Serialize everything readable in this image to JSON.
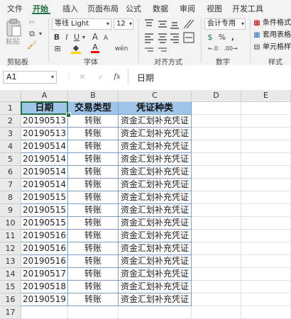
{
  "tabs": [
    "文件",
    "开始",
    "插入",
    "页面布局",
    "公式",
    "数据",
    "审阅",
    "视图",
    "开发工具"
  ],
  "ribbon": {
    "clipboard": {
      "paste_label": "粘贴",
      "group_label": "剪贴板"
    },
    "font": {
      "font_name": "等线 Light",
      "font_size": "12",
      "bold": "B",
      "italic": "I",
      "underline": "U",
      "grow": "A",
      "shrink": "A",
      "font_color": "A",
      "phonetic": "wén",
      "group_label": "字体"
    },
    "alignment": {
      "group_label": "对齐方式"
    },
    "number": {
      "format": "会计专用",
      "percent": "%",
      "comma": ",",
      "currency": "$",
      "group_label": "数字"
    },
    "styles": {
      "conditional": "条件格式",
      "table": "套用表格格",
      "cell": "单元格样式",
      "group_label": "样式"
    }
  },
  "formula_bar": {
    "name_box": "A1",
    "fx": "fx",
    "cancel": "✕",
    "enter": "✓",
    "content": "日期"
  },
  "columns": [
    "A",
    "B",
    "C",
    "D",
    "E"
  ],
  "rows": [
    "1",
    "2",
    "3",
    "4",
    "5",
    "6",
    "7",
    "8",
    "9",
    "10",
    "11",
    "12",
    "13",
    "14",
    "15",
    "16",
    "17"
  ],
  "table": {
    "headers": [
      "日期",
      "交易类型",
      "凭证种类"
    ],
    "data": [
      [
        "20190513",
        "转账",
        "资金汇划补充凭证"
      ],
      [
        "20190513",
        "转账",
        "资金汇划补充凭证"
      ],
      [
        "20190514",
        "转账",
        "资金汇划补充凭证"
      ],
      [
        "20190514",
        "转账",
        "资金汇划补充凭证"
      ],
      [
        "20190514",
        "转账",
        "资金汇划补充凭证"
      ],
      [
        "20190514",
        "转账",
        "资金汇划补充凭证"
      ],
      [
        "20190515",
        "转账",
        "资金汇划补充凭证"
      ],
      [
        "20190515",
        "转账",
        "资金汇划补充凭证"
      ],
      [
        "20190515",
        "转账",
        "资金汇划补充凭证"
      ],
      [
        "20190516",
        "转账",
        "资金汇划补充凭证"
      ],
      [
        "20190516",
        "转账",
        "资金汇划补充凭证"
      ],
      [
        "20190516",
        "转账",
        "资金汇划补充凭证"
      ],
      [
        "20190517",
        "转账",
        "资金汇划补充凭证"
      ],
      [
        "20190518",
        "转账",
        "资金汇划补充凭证"
      ],
      [
        "20190519",
        "转账",
        "资金汇划补充凭证"
      ]
    ]
  },
  "colors": {
    "accent": "#217346",
    "header_fill": "#9fc5e8",
    "table_border": "#7ba0cd"
  }
}
